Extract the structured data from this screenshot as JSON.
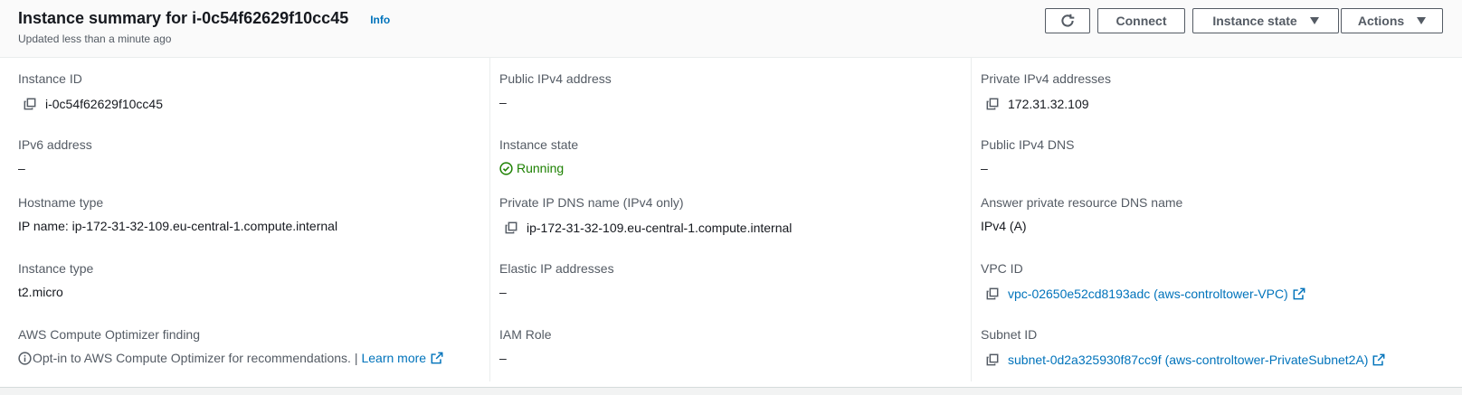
{
  "header": {
    "title": "Instance summary for i-0c54f62629f10cc45",
    "info_label": "Info",
    "subtitle": "Updated less than a minute ago",
    "buttons": {
      "refresh_icon": "refresh-icon",
      "connect_label": "Connect",
      "instance_state_label": "Instance state",
      "actions_label": "Actions"
    }
  },
  "details": {
    "instance_id": {
      "label": "Instance ID",
      "value": "i-0c54f62629f10cc45"
    },
    "public_ipv4": {
      "label": "Public IPv4 address",
      "value": "–"
    },
    "private_ipv4": {
      "label": "Private IPv4 addresses",
      "value": "172.31.32.109"
    },
    "ipv6": {
      "label": "IPv6 address",
      "value": "–"
    },
    "instance_state": {
      "label": "Instance state",
      "value": "Running",
      "status_color": "#1d8102"
    },
    "public_dns": {
      "label": "Public IPv4 DNS",
      "value": "–"
    },
    "hostname_type": {
      "label": "Hostname type",
      "value": "IP name: ip-172-31-32-109.eu-central-1.compute.internal"
    },
    "private_dns": {
      "label": "Private IP DNS name (IPv4 only)",
      "value": "ip-172-31-32-109.eu-central-1.compute.internal"
    },
    "answer_dns": {
      "label": "Answer private resource DNS name",
      "value": "IPv4 (A)"
    },
    "instance_type": {
      "label": "Instance type",
      "value": "t2.micro"
    },
    "elastic_ip": {
      "label": "Elastic IP addresses",
      "value": "–"
    },
    "vpc_id": {
      "label": "VPC ID",
      "value": "vpc-02650e52cd8193adc (aws-controltower-VPC)"
    },
    "optimizer": {
      "label": "AWS Compute Optimizer finding",
      "text": "Opt-in to AWS Compute Optimizer for recommendations. |",
      "link": "Learn more"
    },
    "iam_role": {
      "label": "IAM Role",
      "value": "–"
    },
    "subnet_id": {
      "label": "Subnet ID",
      "value": "subnet-0d2a325930f87cc9f (aws-controltower-PrivateSubnet2A)"
    }
  },
  "colors": {
    "link": "#0073bb",
    "label": "#545b64",
    "success": "#1d8102"
  }
}
